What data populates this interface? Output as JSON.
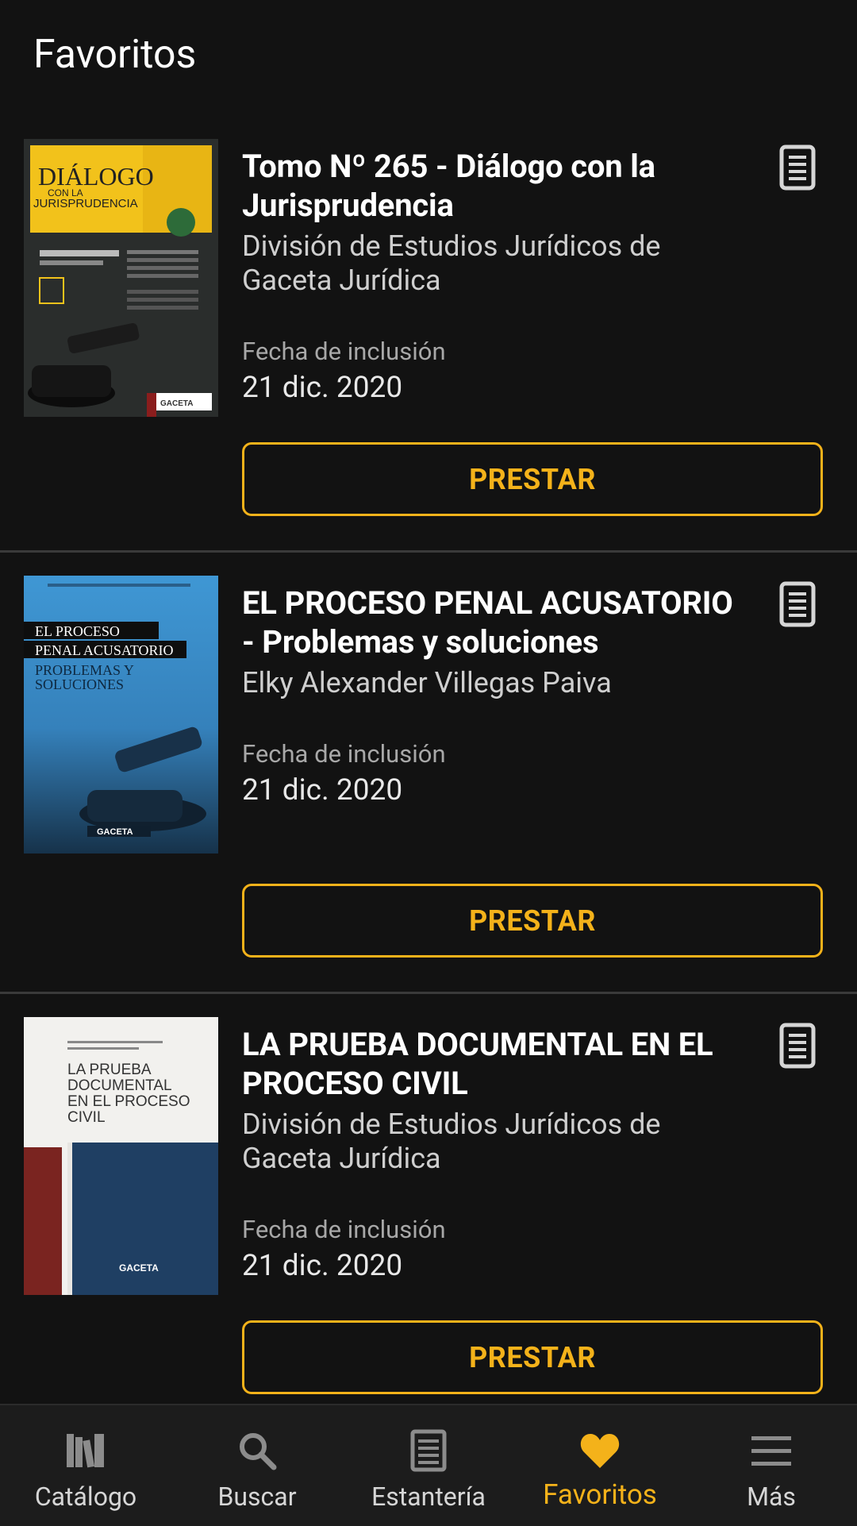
{
  "header": {
    "title": "Favoritos"
  },
  "favorites": [
    {
      "title": "Tomo  Nº 265 - Diálogo con la Jurisprudencia",
      "author": "División de Estudios Jurídicos de Gaceta Jurídica",
      "date_label": "Fecha de inclusión",
      "date_value": "21 dic. 2020",
      "action_label": "PRESTAR",
      "cover": {
        "heading": "DIÁLOGO",
        "subheading": "CON LA",
        "subheading2": "JURISPRUDENCIA",
        "publisher": "GACETA"
      }
    },
    {
      "title": "EL PROCESO PENAL ACUSATORIO - Problemas y soluciones",
      "author": "Elky Alexander Villegas Paiva",
      "date_label": "Fecha de inclusión",
      "date_value": "21 dic. 2020",
      "action_label": "PRESTAR",
      "cover": {
        "line1": "EL PROCESO",
        "line2": "PENAL ACUSATORIO",
        "line3": "PROBLEMAS Y",
        "line4": "SOLUCIONES",
        "publisher": "GACETA"
      }
    },
    {
      "title": "LA PRUEBA DOCUMENTAL EN EL PROCESO CIVIL",
      "author": "División de Estudios Jurídicos de Gaceta Jurídica",
      "date_label": "Fecha de inclusión",
      "date_value": "21 dic. 2020",
      "action_label": "PRESTAR",
      "cover": {
        "line1": "LA PRUEBA",
        "line2": "DOCUMENTAL",
        "line3": "EN EL PROCESO",
        "line4": "CIVIL",
        "publisher": "GACETA"
      }
    }
  ],
  "bottom_nav": {
    "items": [
      {
        "label": "Catálogo",
        "icon": "catalog-icon"
      },
      {
        "label": "Buscar",
        "icon": "search-icon"
      },
      {
        "label": "Estantería",
        "icon": "shelf-icon"
      },
      {
        "label": "Favoritos",
        "icon": "heart-icon",
        "active": true
      },
      {
        "label": "Más",
        "icon": "menu-icon"
      }
    ]
  },
  "colors": {
    "background": "#121212",
    "accent": "#f4b21a",
    "nav_background": "#1c1c1c"
  }
}
